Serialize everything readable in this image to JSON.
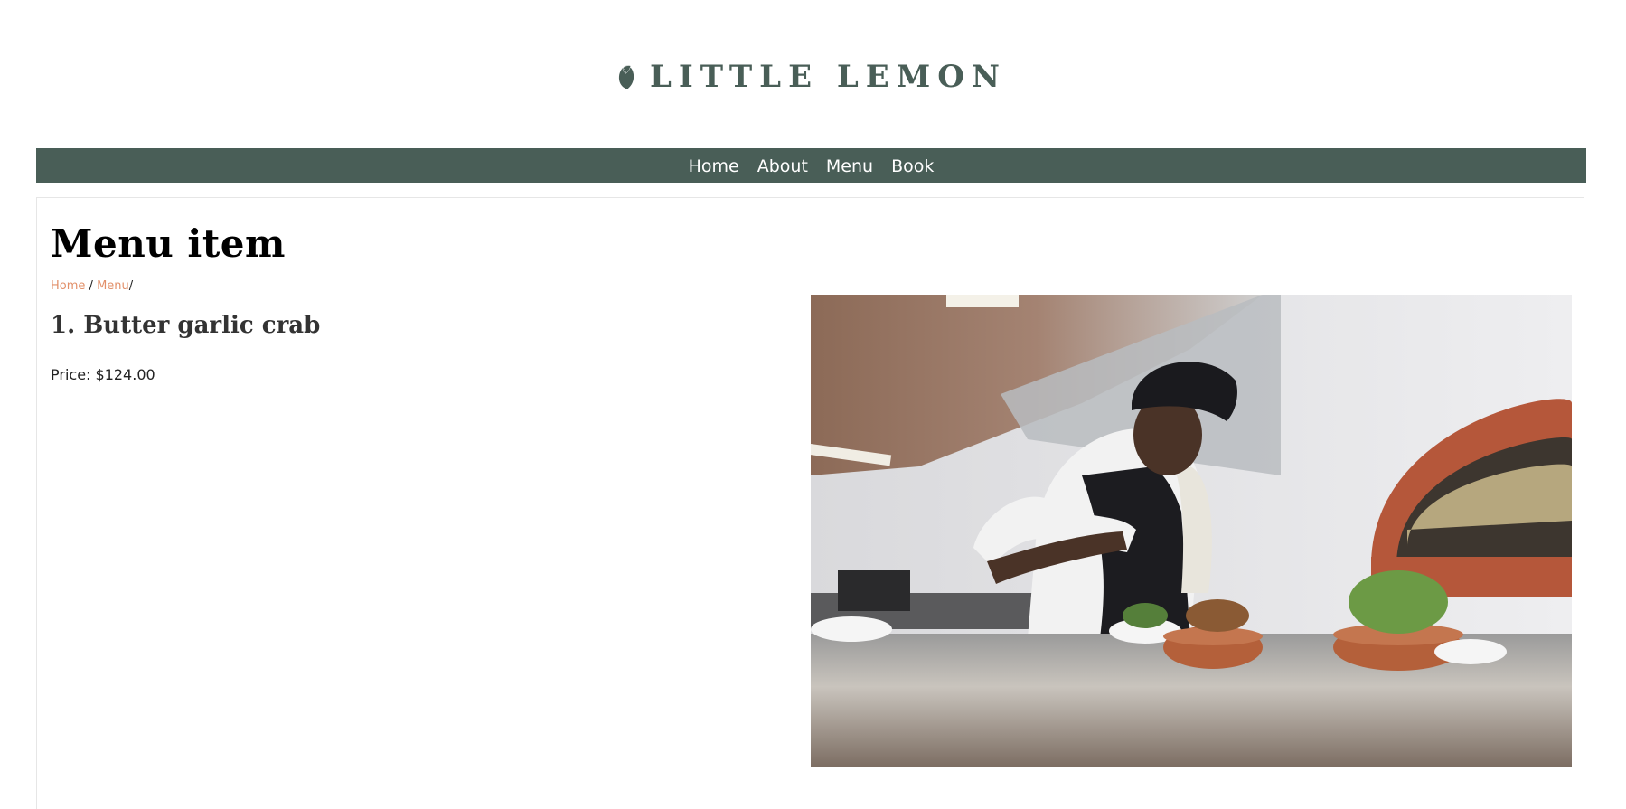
{
  "brand": {
    "name": "LITTLE LEMON",
    "logo_icon": "lemon-icon",
    "color": "#495e57"
  },
  "nav": {
    "items": [
      {
        "label": "Home"
      },
      {
        "label": "About"
      },
      {
        "label": "Menu"
      },
      {
        "label": "Book"
      }
    ]
  },
  "main": {
    "title": "Menu item",
    "breadcrumb": {
      "items": [
        {
          "label": "Home"
        },
        {
          "label": "Menu"
        }
      ],
      "separator": "/",
      "link_color": "#e2906a"
    },
    "item": {
      "title": "1. Butter garlic crab",
      "price": "Price: $124.00"
    },
    "photo": {
      "subject": "chef-plating-photo"
    }
  }
}
